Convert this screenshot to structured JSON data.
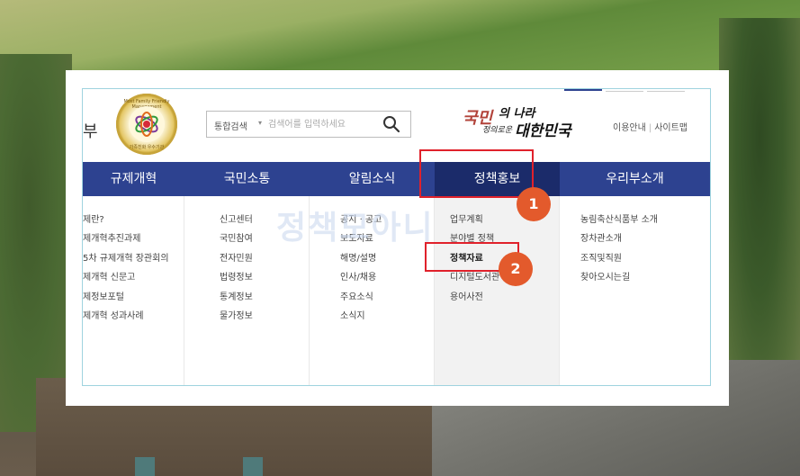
{
  "header": {
    "left_cut_text": "부",
    "emblem": {
      "ring_text": "Most Family Friendly Management",
      "bottom_text": "가족친화 우수기관"
    },
    "search": {
      "category_label": "통합검색",
      "placeholder": "검색어를 입력하세요",
      "button_icon": "search-icon"
    },
    "slogan": {
      "line1": "국민",
      "line1_small": "의 나라",
      "line2": "정의로운",
      "line2_big": "대한민국"
    },
    "util_links": [
      "이용안내",
      "사이트맵"
    ]
  },
  "nav": {
    "items": [
      {
        "label": "규제개혁"
      },
      {
        "label": "국민소통"
      },
      {
        "label": "알림소식"
      },
      {
        "label": "정책홍보"
      },
      {
        "label": "우리부소개"
      }
    ]
  },
  "menu": {
    "columns": [
      {
        "items": [
          "제란?",
          "제개혁추진과제",
          "5차 규제개혁 장관회의",
          "제개혁 신문고",
          "제정보포털",
          "제개혁 성과사례"
        ]
      },
      {
        "items": [
          "신고센터",
          "국민참여",
          "전자민원",
          "법령정보",
          "통계정보",
          "물가정보"
        ]
      },
      {
        "items": [
          "공지 · 공고",
          "보도자료",
          "해명/설명",
          "인사/채용",
          "주요소식",
          "소식지"
        ]
      },
      {
        "items": [
          "업무계획",
          "분야별 정책",
          "정책자료",
          "디지털도서관",
          "용어사전"
        ]
      },
      {
        "items": [
          "농림축산식품부 소개",
          "장차관소개",
          "조직및직원",
          "찾아오시는길"
        ]
      }
    ]
  },
  "watermark": "정책모아니",
  "annotations": [
    {
      "label": "1"
    },
    {
      "label": "2"
    }
  ],
  "colors": {
    "nav_bg": "#2d4290",
    "nav_active": "#1b2b6a",
    "highlight": "#e0212b",
    "step_badge": "#e35a2c"
  }
}
